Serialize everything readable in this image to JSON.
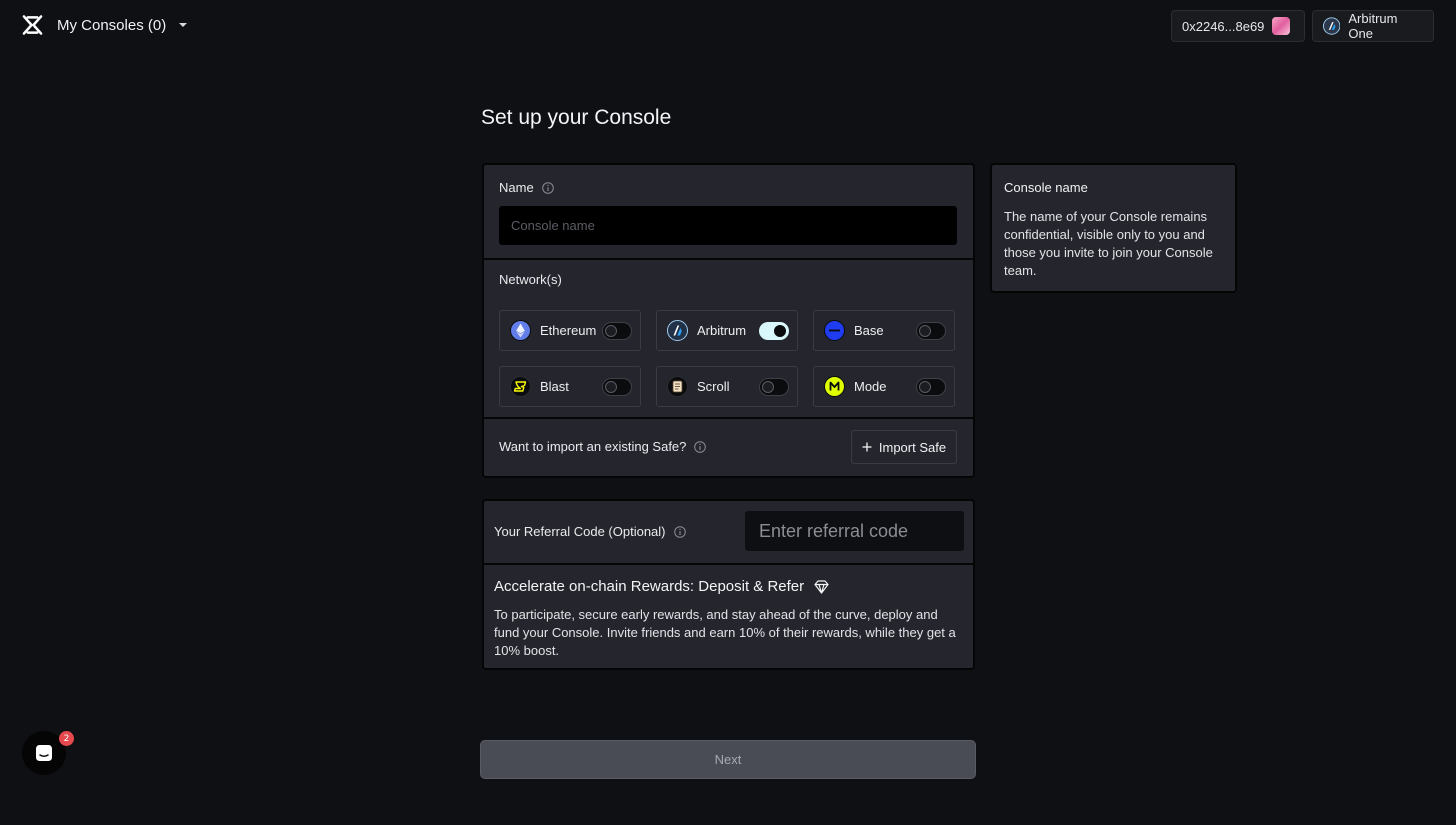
{
  "header": {
    "title": "My Consoles (0)",
    "wallet_address": "0x2246...8e69",
    "network_name": "Arbitrum One"
  },
  "page": {
    "title": "Set up your Console"
  },
  "form": {
    "name_label": "Name",
    "name_placeholder": "Console name",
    "name_value": "",
    "networks_label": "Network(s)",
    "networks": [
      {
        "name": "Ethereum",
        "icon": "ethereum-icon",
        "enabled": false
      },
      {
        "name": "Arbitrum",
        "icon": "arbitrum-icon",
        "enabled": true
      },
      {
        "name": "Base",
        "icon": "base-icon",
        "enabled": false
      },
      {
        "name": "Blast",
        "icon": "blast-icon",
        "enabled": false
      },
      {
        "name": "Scroll",
        "icon": "scroll-icon",
        "enabled": false
      },
      {
        "name": "Mode",
        "icon": "mode-icon",
        "enabled": false
      }
    ],
    "import_question": "Want to import an existing Safe?",
    "import_button": "Import Safe"
  },
  "side_info": {
    "title": "Console name",
    "body": "The name of your Console remains confidential, visible only to you and those you invite to join your Console team."
  },
  "referral": {
    "label": "Your Referral Code (Optional)",
    "placeholder": "Enter referral code",
    "value": "",
    "promo_title": "Accelerate on-chain Rewards: Deposit & Refer",
    "promo_body": "To participate, secure early rewards, and stay ahead of the curve, deploy and fund your Console. Invite friends and earn 10% of their rewards, while they get a 10% boost."
  },
  "footer": {
    "next_button": "Next"
  },
  "chat": {
    "badge_count": "2"
  },
  "colors": {
    "background": "#0f1013",
    "card": "#25262d",
    "toggle_on": "#d9f8fb",
    "next_disabled": "#4a4c55",
    "badge": "#e5484d"
  }
}
